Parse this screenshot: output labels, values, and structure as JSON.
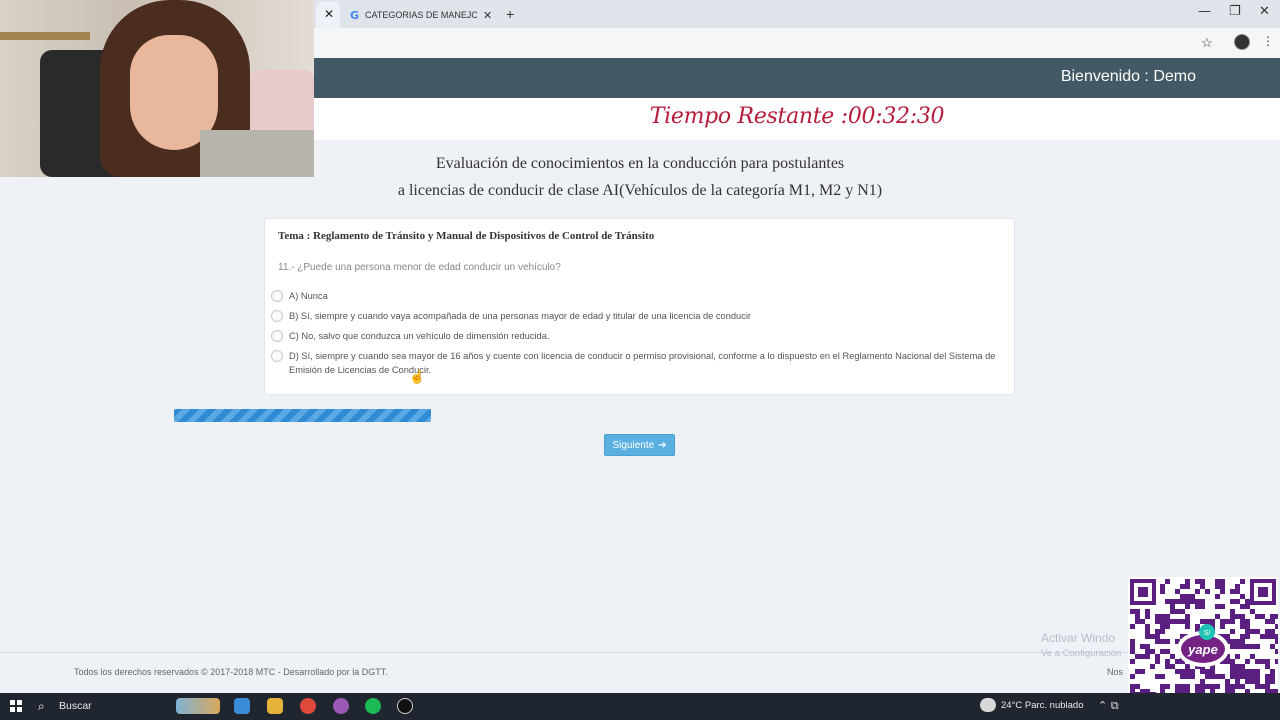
{
  "browser": {
    "tab_active_close": "✕",
    "tab2_icon": "G",
    "tab2_title": "CATEGORIAS DE MANEJO - Bus",
    "tab2_close": "✕",
    "new_tab": "+",
    "window_controls": [
      "—",
      "❐",
      "✕"
    ],
    "bookmark_icon": "☆",
    "menu_icon": "⋮"
  },
  "header": {
    "welcome": "Bienvenido : Demo"
  },
  "timer": {
    "label": "Tiempo Restante :",
    "value": "00:32:30"
  },
  "exam": {
    "title_line1": "Evaluación de conocimientos en la conducción para postulantes",
    "title_line2": "a licencias de conducir de clase AI(Vehículos de la categoría M1, M2 y N1)",
    "topic": "Tema : Reglamento de Tránsito y Manual de Dispositivos de Control de Tránsito",
    "question": "11.- ¿Puede una persona menor de edad conducir un vehículo?",
    "options": [
      "A) Nunca",
      "B) Sí, siempre y cuando vaya acompañada de una personas mayor de edad y titular de una licencia de conducir",
      "C) No, salvo que conduzca un vehículo de dimensión reducida.",
      "D) Sí, siempre y cuando sea mayor de 16 años y cuente con licencia de conducir o permiso provisional, conforme a lo dispuesto en el Reglamento Nacional del Sistema de Emisión de Licencias de Conducir."
    ],
    "progress_fraction": 0.26,
    "next_label": "Siguiente"
  },
  "footer": {
    "copyright": "Todos los derechos reservados © 2017-2018 MTC - Desarrollado por la DGTT.",
    "right_link": "Nos"
  },
  "windows_watermark": {
    "line1": "Activar Windo",
    "line2": "Ve a Configuración"
  },
  "overlay": {
    "qr_brand": "yape",
    "qr_badge": "S/"
  },
  "taskbar": {
    "search_placeholder": "Buscar",
    "weather": "24°C  Parc. nublado",
    "tray": "⌃  ⧉",
    "app_colors": [
      "#d9a75b",
      "#3a8bd8",
      "#e5b33a",
      "#e04a3a",
      "#9b59b6",
      "#1db954",
      "#111111"
    ]
  },
  "colors": {
    "navbar": "#435a66",
    "timer": "#b51c3a",
    "next_button": "#5ab0e0",
    "progress": "#2e8bd4",
    "qr_purple": "#5b1f82"
  }
}
